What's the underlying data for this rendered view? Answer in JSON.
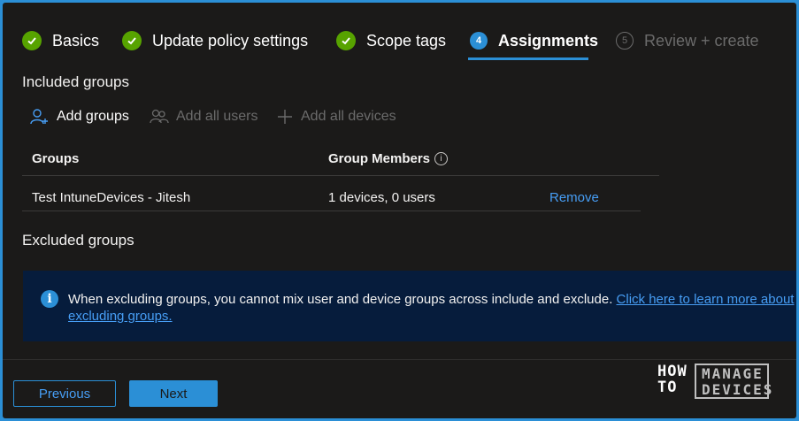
{
  "wizard": {
    "steps": [
      {
        "label": "Basics",
        "state": "complete"
      },
      {
        "label": "Update policy settings",
        "state": "complete"
      },
      {
        "label": "Scope tags",
        "state": "complete"
      },
      {
        "label": "Assignments",
        "number": "4",
        "state": "active"
      },
      {
        "label": "Review + create",
        "number": "5",
        "state": "disabled"
      }
    ]
  },
  "included": {
    "title": "Included groups",
    "add_groups": "Add groups",
    "add_all_users": "Add all users",
    "add_all_devices": "Add all devices",
    "columns": {
      "groups": "Groups",
      "members": "Group Members"
    },
    "rows": [
      {
        "group": "Test IntuneDevices - Jitesh",
        "members": "1 devices, 0 users",
        "action": "Remove"
      }
    ]
  },
  "excluded": {
    "title": "Excluded groups",
    "info_text": "When excluding groups, you cannot mix user and device groups across include and exclude.",
    "info_link": "Click here to learn more about excluding groups."
  },
  "footer": {
    "previous": "Previous",
    "next": "Next"
  },
  "logo": {
    "line1": "HOW",
    "line2": "TO",
    "line3": "MANAGE",
    "line4": "DEVICES"
  },
  "colors": {
    "accent": "#2b8fd6",
    "complete": "#57a300",
    "link": "#479ef5",
    "background": "#1b1a19",
    "info_banner": "#061c3c"
  }
}
